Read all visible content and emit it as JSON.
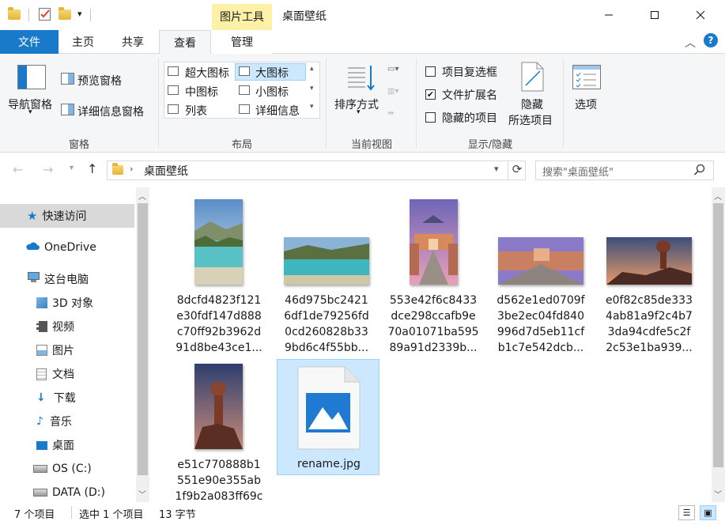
{
  "window": {
    "title": "桌面壁纸",
    "context_group": "图片工具"
  },
  "tabs": {
    "file": "文件",
    "home": "主页",
    "share": "共享",
    "view": "查看",
    "manage": "管理"
  },
  "ribbon": {
    "panes": {
      "nav_pane": "导航窗格",
      "preview_pane": "预览窗格",
      "details_pane": "详细信息窗格",
      "label": "窗格"
    },
    "layout": {
      "extra_large": "超大图标",
      "large": "大图标",
      "medium": "中图标",
      "small": "小图标",
      "list": "列表",
      "details": "详细信息",
      "label": "布局"
    },
    "current_view": {
      "sort_by": "排序方式",
      "label": "当前视图"
    },
    "show_hide": {
      "item_checkboxes": "项目复选框",
      "file_extensions": "文件扩展名",
      "hidden_items": "隐藏的项目",
      "hide_selected_line1": "隐藏",
      "hide_selected_line2": "所选项目",
      "label": "显示/隐藏",
      "item_checkboxes_checked": false,
      "file_extensions_checked": true,
      "hidden_items_checked": false
    },
    "options": "选项"
  },
  "address": {
    "path": "桌面壁纸",
    "search_placeholder": "搜索\"桌面壁纸\""
  },
  "nav": {
    "quick_access": "快速访问",
    "onedrive": "OneDrive",
    "this_pc": "这台电脑",
    "objects_3d": "3D 对象",
    "videos": "视频",
    "pictures": "图片",
    "documents": "文档",
    "downloads": "下载",
    "music": "音乐",
    "desktop": "桌面",
    "drive_c": "OS (C:)",
    "drive_d": "DATA (D:)"
  },
  "files": [
    {
      "lines": [
        "8dcfd4823f121",
        "e30fdf147d888",
        "c70ff92b3962d",
        "91d8be43ce1..."
      ],
      "thumb": "lake-portrait"
    },
    {
      "lines": [
        "46d975bc2421",
        "6df1de79256fd",
        "0cd260828b33",
        "9bd6c4f55bb..."
      ],
      "thumb": "lake-landscape"
    },
    {
      "lines": [
        "553e42f6c8433",
        "dce298ccafb9e",
        "70a01071ba595",
        "89a91d2339b..."
      ],
      "thumb": "arch-portrait"
    },
    {
      "lines": [
        "d562e1ed0709f",
        "3be2ec04fd840",
        "996d7d5eb11cf",
        "b1c7e542dcb..."
      ],
      "thumb": "arch-landscape"
    },
    {
      "lines": [
        "e0f82c85de333",
        "4ab81a9f2c4b7",
        "3da94cdfe5c2f",
        "2c53e1ba939..."
      ],
      "thumb": "rock-landscape"
    },
    {
      "lines": [
        "e51c770888b1",
        "551e90e355ab",
        "1f9b2a083ff69c"
      ],
      "thumb": "rock-portrait"
    },
    {
      "lines": [
        "rename.jpg"
      ],
      "thumb": "image-file-icon"
    }
  ],
  "status": {
    "count": "7 个项目",
    "selection": "选中 1 个项目",
    "size": "13 字节"
  },
  "colors": {
    "accent": "#1979ca",
    "selection": "#cce8ff",
    "selection_border": "#99d1ff",
    "context_tab": "#fdf1a8"
  }
}
